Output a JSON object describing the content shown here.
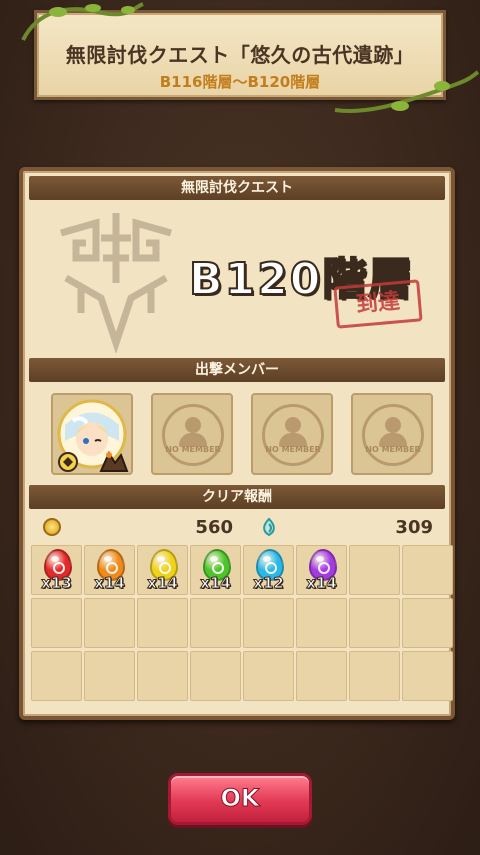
{
  "banner": {
    "title": "無限討伐クエスト「悠久の古代遺跡」",
    "subtitle": "B116階層～B120階層"
  },
  "panel": {
    "header": "無限討伐クエスト",
    "floor": "B120階層",
    "stamp": "到達",
    "members_header": "出撃メンバー",
    "members": [
      {
        "type": "character",
        "icon": "character-portrait"
      },
      {
        "type": "empty",
        "label": "NO MEMBER"
      },
      {
        "type": "empty",
        "label": "NO MEMBER"
      },
      {
        "type": "empty",
        "label": "NO MEMBER"
      }
    ],
    "rewards_header": "クリア報酬",
    "gold": "560",
    "exp": "309",
    "items": [
      {
        "color": "#e32a2a",
        "count": "x13",
        "icon": "red-egg-icon"
      },
      {
        "color": "#f08a1a",
        "count": "x14",
        "icon": "orange-egg-icon"
      },
      {
        "color": "#f0d21a",
        "count": "x14",
        "icon": "yellow-egg-icon"
      },
      {
        "color": "#4ec42a",
        "count": "x14",
        "icon": "green-egg-icon"
      },
      {
        "color": "#2ab8e8",
        "count": "x12",
        "icon": "blue-egg-icon"
      },
      {
        "color": "#a43ae0",
        "count": "x14",
        "icon": "purple-egg-icon"
      }
    ]
  },
  "ok_button": "OK"
}
